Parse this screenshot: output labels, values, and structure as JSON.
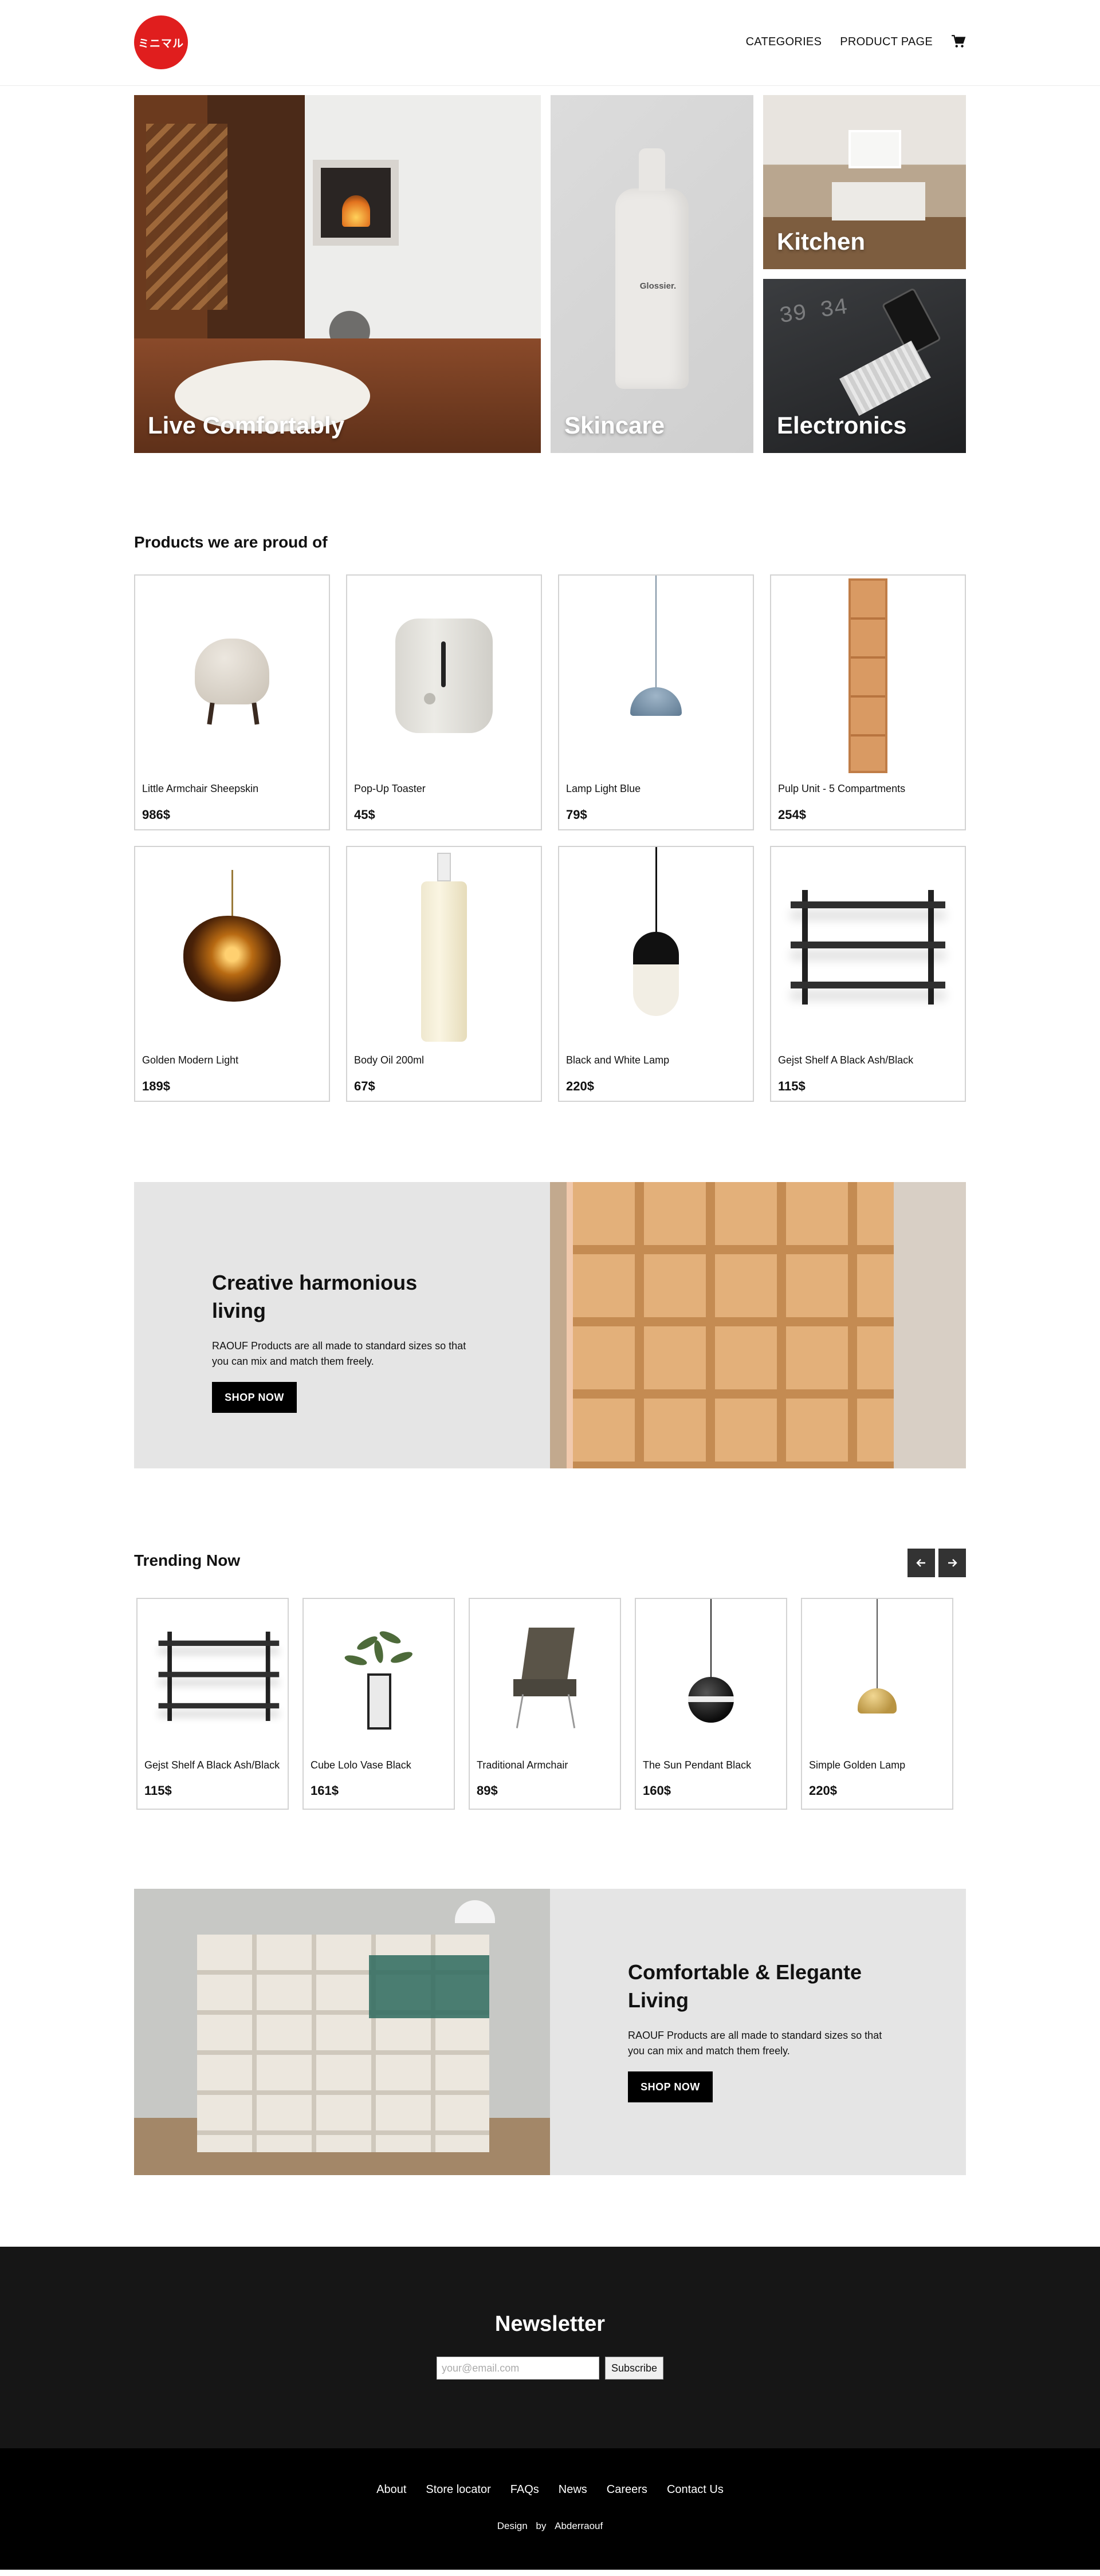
{
  "header": {
    "logo_text": "ミニマル",
    "nav": [
      "CATEGORIES",
      "PRODUCT PAGE"
    ],
    "cart_icon": "shopping-cart-icon"
  },
  "hero": {
    "tiles": [
      {
        "label": "Live Comfortably"
      },
      {
        "label": "Skincare",
        "bottle_brand": "Glossier."
      },
      {
        "label": "Kitchen"
      },
      {
        "label": "Electronics",
        "digits": "39 34"
      }
    ]
  },
  "proud": {
    "title": "Products we are proud of",
    "products": [
      {
        "name": "Little Armchair Sheepskin",
        "price": "986$"
      },
      {
        "name": "Pop-Up Toaster",
        "price": "45$"
      },
      {
        "name": "Lamp Light Blue",
        "price": "79$"
      },
      {
        "name": "Pulp Unit - 5 Compartments",
        "price": "254$"
      },
      {
        "name": "Golden Modern Light",
        "price": "189$"
      },
      {
        "name": "Body Oil 200ml",
        "price": "67$"
      },
      {
        "name": "Black and White Lamp",
        "price": "220$"
      },
      {
        "name": "Gejst Shelf A Black Ash/Black",
        "price": "115$"
      }
    ]
  },
  "banner1": {
    "title": "Creative harmonious living",
    "text": "RAOUF Products are all made to standard sizes so that you can mix and match them freely.",
    "button": "SHOP NOW"
  },
  "trending": {
    "title": "Trending Now",
    "prev_icon": "arrow-left-icon",
    "next_icon": "arrow-right-icon",
    "items": [
      {
        "name": "Gejst Shelf A Black Ash/Black",
        "price": "115$"
      },
      {
        "name": "Cube Lolo Vase Black",
        "price": "161$"
      },
      {
        "name": "Traditional Armchair",
        "price": "89$"
      },
      {
        "name": "The Sun Pendant Black",
        "price": "160$"
      },
      {
        "name": "Simple Golden Lamp",
        "price": "220$"
      }
    ]
  },
  "banner2": {
    "title": "Comfortable & Elegante Living",
    "text": "RAOUF Products are all made to standard sizes so that you can mix and match them freely.",
    "button": "SHOP NOW"
  },
  "newsletter": {
    "title": "Newsletter",
    "placeholder": "your@email.com",
    "button": "Subscribe"
  },
  "footer": {
    "links": [
      "About",
      "Store locator",
      "FAQs",
      "News",
      "Careers",
      "Contact Us"
    ],
    "credit_prefix": "Design",
    "credit_by": "by",
    "credit_name": "Abderraouf"
  },
  "colors": {
    "brand_red": "#e01e1e",
    "banner_gray": "#e5e5e5",
    "newsletter_bg": "#161616",
    "footer_bg": "#000000"
  }
}
